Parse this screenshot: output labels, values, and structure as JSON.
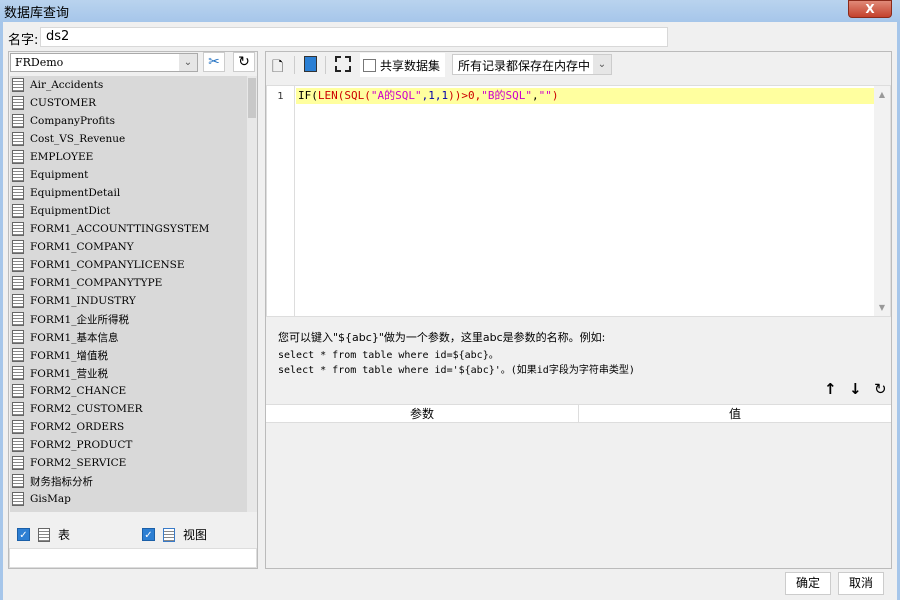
{
  "window": {
    "title": "数据库查询",
    "close": "X"
  },
  "name": {
    "label": "名字:",
    "value": "ds2"
  },
  "left": {
    "connection": "FRDemo",
    "tables": [
      "Air_Accidents",
      "CUSTOMER",
      "CompanyProfits",
      "Cost_VS_Revenue",
      "EMPLOYEE",
      "Equipment",
      "EquipmentDetail",
      "EquipmentDict",
      "FORM1_ACCOUNTTINGSYSTEM",
      "FORM1_COMPANY",
      "FORM1_COMPANYLICENSE",
      "FORM1_COMPANYTYPE",
      "FORM1_INDUSTRY",
      "FORM1_企业所得税",
      "FORM1_基本信息",
      "FORM1_增值税",
      "FORM1_营业税",
      "FORM2_CHANCE",
      "FORM2_CUSTOMER",
      "FORM2_ORDERS",
      "FORM2_PRODUCT",
      "FORM2_SERVICE",
      "财务指标分析",
      "GisMap"
    ],
    "table_label": "表",
    "view_label": "视图"
  },
  "toolbar": {
    "share_label": "共享数据集",
    "storage": "所有记录都保存在内存中"
  },
  "editor": {
    "line_number": "1",
    "code": {
      "p1": "IF(",
      "p2": "LEN(",
      "p3": "SQL(",
      "p4": "\"A的SQL\"",
      "p5": ",1,1",
      ")1": "",
      "p6": "))>0,",
      "p7": "\"B的SQL\"",
      "p8": ",",
      "p9": "\"\"",
      "p10": ")"
    }
  },
  "help": {
    "line1": "您可以键入\"${abc}\"做为一个参数，这里abc是参数的名称。例如:",
    "line2": "select * from table where id=${abc}。",
    "line3": "select * from table where id='${abc}'。(如果id字段为字符串类型)"
  },
  "params": {
    "col_param": "参数",
    "col_value": "值"
  },
  "buttons": {
    "ok": "确定",
    "cancel": "取消"
  }
}
